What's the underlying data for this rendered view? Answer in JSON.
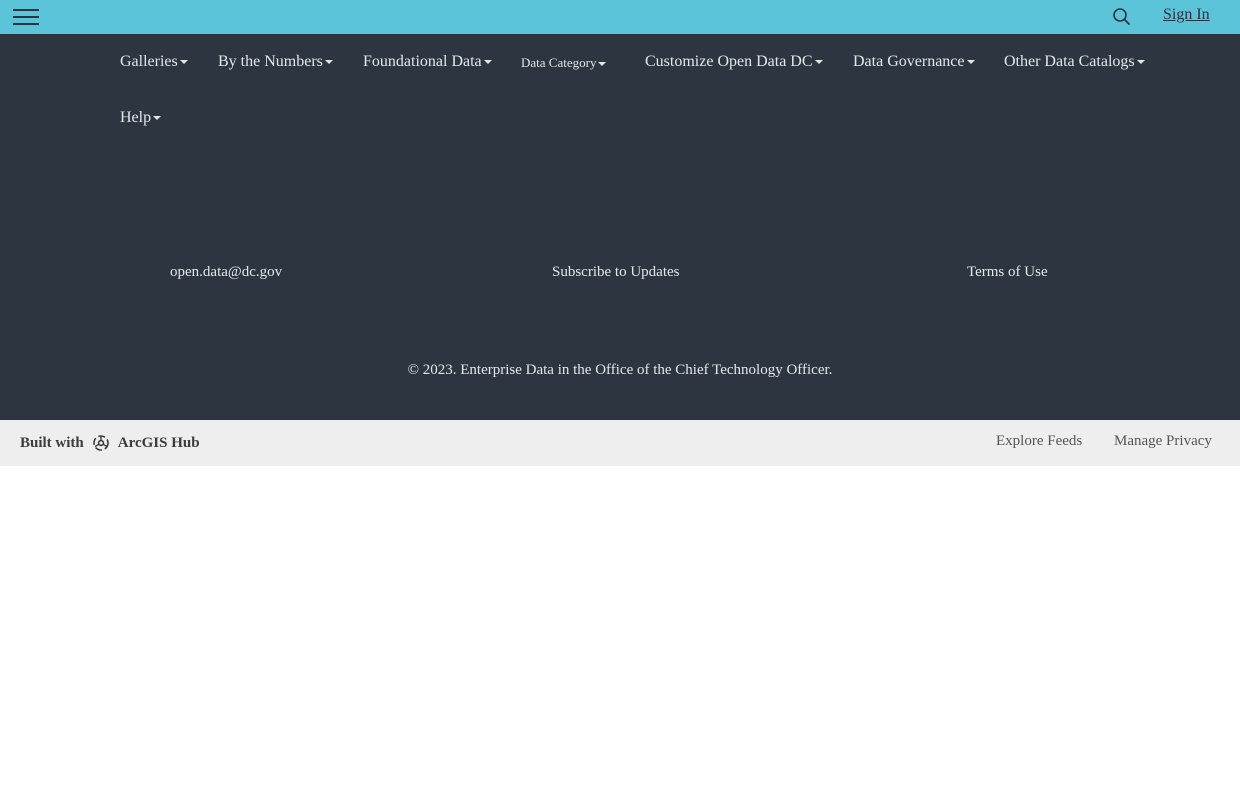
{
  "header": {
    "menu_icon": "hamburger-menu-icon",
    "search_icon": "search-icon",
    "signin_label": "Sign In"
  },
  "nav": {
    "items": [
      {
        "label": "Galleries"
      },
      {
        "label": "By the Numbers"
      },
      {
        "label": "Foundational Data"
      },
      {
        "label": "Data Category"
      },
      {
        "label": "Customize Open Data DC"
      },
      {
        "label": "Data Governance"
      },
      {
        "label": "Other Data Catalogs"
      },
      {
        "label": "Help"
      }
    ]
  },
  "footer": {
    "links": [
      {
        "label": "open.data@dc.gov"
      },
      {
        "label": "Subscribe to Updates"
      },
      {
        "label": "Terms of Use"
      }
    ],
    "copyright": "© 2023. Enterprise Data in the Office of the Chief Technology Officer."
  },
  "bottom": {
    "built_with": "Built with",
    "hub_name": "ArcGIS Hub",
    "hub_icon": "arcgis-hub-icon",
    "explore_feeds": "Explore Feeds",
    "manage_privacy": "Manage Privacy"
  },
  "colors": {
    "topbar": "#5bc4d8",
    "footer": "#2d3540",
    "bottom_bar": "#eeeeee"
  }
}
